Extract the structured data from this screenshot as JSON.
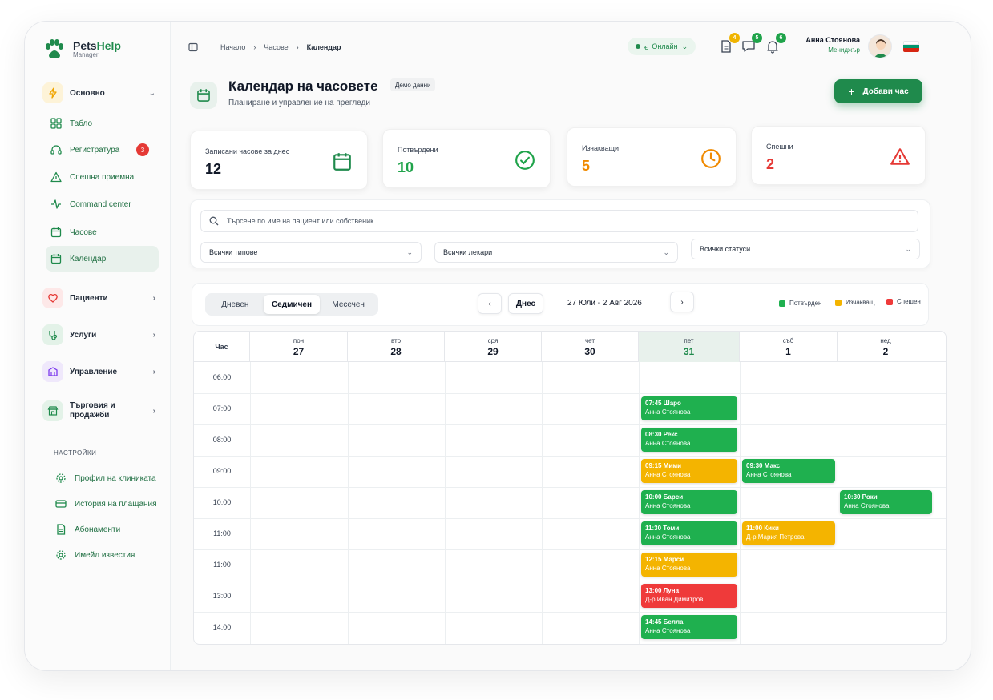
{
  "brand": {
    "name_a": "Pets",
    "name_b": "Help",
    "sub": "Manager"
  },
  "sidebar": {
    "group_main": "Основно",
    "items": [
      {
        "label": "Табло"
      },
      {
        "label": "Регистратура",
        "badge": "3"
      },
      {
        "label": "Спешна приемна"
      },
      {
        "label": "Command center"
      },
      {
        "label": "Часове"
      },
      {
        "label": "Календар"
      }
    ],
    "groups": [
      {
        "label": "Пациенти"
      },
      {
        "label": "Услуги"
      },
      {
        "label": "Управление"
      },
      {
        "label": "Търговия и продажби"
      }
    ],
    "settings_label": "НАСТРОЙКИ",
    "settings": [
      {
        "label": "Профил на клиниката"
      },
      {
        "label": "История на плащания"
      },
      {
        "label": "Абонаменти"
      },
      {
        "label": "Имейл известия"
      }
    ]
  },
  "topbar": {
    "breadcrumb": [
      "Начало",
      "Часове",
      "Календар"
    ],
    "status": "Онлайн",
    "badges": {
      "docs": "4",
      "messages": "5",
      "notifications": "6"
    },
    "user_name": "Анна Стоянова",
    "user_role": "Мениджър"
  },
  "page": {
    "title": "Календар на часовете",
    "tag": "Демо данни",
    "subtitle": "Планиране и управление на прегледи",
    "add_button": "Добави час"
  },
  "stats": [
    {
      "label": "Записани часове за днес",
      "value": "12",
      "color": "#111827"
    },
    {
      "label": "Потвърдени",
      "value": "10",
      "color": "#1fa34a"
    },
    {
      "label": "Изчакващи",
      "value": "5",
      "color": "#f08a00"
    },
    {
      "label": "Спешни",
      "value": "2",
      "color": "#e53935"
    }
  ],
  "filters": {
    "search_placeholder": "Търсене по име на пациент или собственик...",
    "types": "Всички типове",
    "doctors": "Всички лекари",
    "statuses": "Всички статуси"
  },
  "toolbar": {
    "views": [
      "Дневен",
      "Седмичен",
      "Месечен"
    ],
    "today": "Днес",
    "range": "27 Юли - 2 Авг 2026",
    "legend": [
      "Потвърден",
      "Изчакващ",
      "Спешен"
    ]
  },
  "colors": {
    "confirmed": "#1fb04f",
    "pending": "#f4b400",
    "urgent": "#ef3a3a",
    "brand": "#1f8a4c"
  },
  "calendar": {
    "hour_label": "Час",
    "days": [
      {
        "name": "пон",
        "num": "27"
      },
      {
        "name": "вто",
        "num": "28"
      },
      {
        "name": "сря",
        "num": "29"
      },
      {
        "name": "чет",
        "num": "30"
      },
      {
        "name": "пет",
        "num": "31"
      },
      {
        "name": "съб",
        "num": "1"
      },
      {
        "name": "нед",
        "num": "2"
      }
    ],
    "hours": [
      "06:00",
      "07:00",
      "08:00",
      "09:00",
      "10:00",
      "11:00",
      "11:00",
      "13:00",
      "14:00"
    ],
    "appointments": [
      {
        "day": 4,
        "hour": 1,
        "time": "07:45 Шаро",
        "doctor": "Анна Стоянова",
        "status": "confirmed"
      },
      {
        "day": 4,
        "hour": 2,
        "time": "08:30 Рекс",
        "doctor": "Анна Стоянова",
        "status": "confirmed"
      },
      {
        "day": 4,
        "hour": 3,
        "time": "09:15 Мими",
        "doctor": "Анна Стоянова",
        "status": "pending"
      },
      {
        "day": 5,
        "hour": 3,
        "time": "09:30 Макс",
        "doctor": "Анна Стоянова",
        "status": "confirmed"
      },
      {
        "day": 4,
        "hour": 4,
        "time": "10:00 Барси",
        "doctor": "Анна Стоянова",
        "status": "confirmed"
      },
      {
        "day": 6,
        "hour": 4,
        "time": "10:30 Роки",
        "doctor": "Анна Стоянова",
        "status": "confirmed"
      },
      {
        "day": 4,
        "hour": 5,
        "time": "11:30 Томи",
        "doctor": "Анна Стоянова",
        "status": "confirmed"
      },
      {
        "day": 5,
        "hour": 5,
        "time": "11:00 Кики",
        "doctor": "Д-р Мария Петрова",
        "status": "pending"
      },
      {
        "day": 4,
        "hour": 6,
        "time": "12:15 Марси",
        "doctor": "Анна Стоянова",
        "status": "pending"
      },
      {
        "day": 4,
        "hour": 7,
        "time": "13:00 Луна",
        "doctor": "Д-р Иван Димитров",
        "status": "urgent"
      },
      {
        "day": 4,
        "hour": 8,
        "time": "14:45 Белла",
        "doctor": "Анна Стоянова",
        "status": "confirmed"
      }
    ]
  }
}
